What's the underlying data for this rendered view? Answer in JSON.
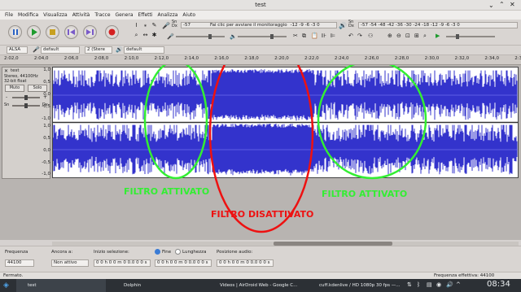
{
  "window": {
    "title": "test"
  },
  "menu": [
    "File",
    "Modifica",
    "Visualizza",
    "Attività",
    "Tracce",
    "Genera",
    "Effetti",
    "Analizza",
    "Aiuto"
  ],
  "meters": {
    "rec_label": "Sn Dx",
    "rec_ticks": "-57",
    "rec_prompt": "Fai clic per avviare il monitoraggio",
    "rec_tail": "-12 -9 -6 -3 0",
    "play_label": "Sn Dx",
    "play_ticks": "-57 -54 -48 -42 -36 -30 -24 -18 -12 -9 -6 -3 0"
  },
  "devices": {
    "host": "ALSA",
    "input": "default",
    "channels": "2 (Stere",
    "output": "default"
  },
  "ruler": [
    "2:02,0",
    "2:04,0",
    "2:06,0",
    "2:08,0",
    "2:10,0",
    "2:12,0",
    "2:14,0",
    "2:16,0",
    "2:18,0",
    "2:20,0",
    "2:22,0",
    "2:24,0",
    "2:26,0",
    "2:28,0",
    "2:30,0",
    "2:32,0",
    "2:34,0",
    "2:36,0"
  ],
  "track": {
    "name": "test",
    "info_line1": "Stereo, 44100Hz",
    "info_line2": "32-bit float",
    "mute": "Muto",
    "solo": "Solo",
    "gain_minus": "-",
    "gain_plus": "+",
    "pan_left": "Sn",
    "pan_right": "Dx",
    "scale": [
      "1,0",
      "0,5",
      "0,0",
      "-0,5",
      "-1,0",
      "1,0",
      "0,5",
      "0,0",
      "-0,5",
      "-1,0"
    ]
  },
  "annotations": {
    "left": "FILTRO ATTIVATO",
    "middle": "FILTRO DISATTIVATO",
    "right": "FILTRO ATTIVATO"
  },
  "selection": {
    "rate_label": "Frequenza",
    "rate_value": "44100",
    "snap_label": "Ancora a:",
    "snap_value": "Non attivo",
    "start_label": "Inizio selezione:",
    "start_value": "0 0 h 0 0 m 0 0.0 0 0 s",
    "end_radio": "Fine",
    "length_radio": "Lunghezza",
    "end_value": "0 0 h 0 0 m 0 0.0 0 0 s",
    "pos_label": "Posizione audio:",
    "pos_value": "0 0 h 0 0 m 0 0.0 0 0 s"
  },
  "status": {
    "left": "Fermato.",
    "right": "Frequenza effettiva: 44100"
  },
  "taskbar": {
    "items": [
      "test",
      "Dolphin",
      "Videos | AirDroid Web - Google C...",
      "cuff.kdenlive / HD 1080p 30 fps —..."
    ],
    "clock": "08:34"
  },
  "colors": {
    "wave": "#3333cc",
    "green": "#33ee33",
    "red": "#ee1111"
  }
}
